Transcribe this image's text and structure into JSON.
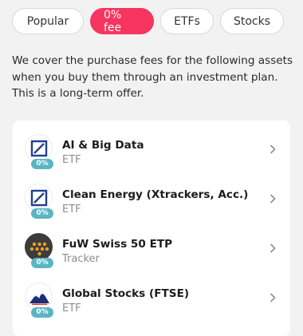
{
  "tabs": [
    {
      "label": "Popular",
      "active": false
    },
    {
      "label": "0% fee",
      "active": true
    },
    {
      "label": "ETFs",
      "active": false
    },
    {
      "label": "Stocks",
      "active": false
    }
  ],
  "intro": "We cover the purchase fees for the following assets when you buy them through an investment plan. This is a long-term offer.",
  "items": [
    {
      "name": "AI & Big Data",
      "type": "ETF",
      "badge": "0%",
      "icon": "deutsche-bank-logo-icon"
    },
    {
      "name": "Clean Energy (Xtrackers, Acc.)",
      "type": "ETF",
      "badge": "0%",
      "icon": "deutsche-bank-logo-icon"
    },
    {
      "name": "FuW Swiss 50 ETP",
      "type": "Tracker",
      "badge": "0%",
      "icon": "dots-logo-icon"
    },
    {
      "name": "Global Stocks (FTSE)",
      "type": "ETF",
      "badge": "0%",
      "icon": "mountain-logo-icon"
    }
  ],
  "colors": {
    "accent": "#f7355e",
    "badge": "#5ab5c3",
    "background": "#f3f2f3"
  }
}
